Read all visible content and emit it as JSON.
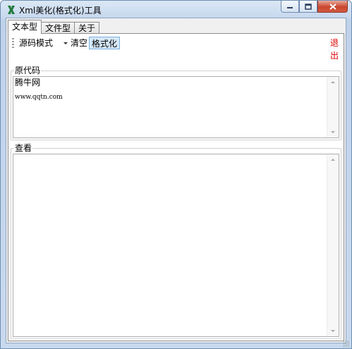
{
  "window": {
    "title": "Xml美化(格式化)工具",
    "icon": "excel-x-icon"
  },
  "tabs": [
    {
      "label": "文本型",
      "active": true
    },
    {
      "label": "文件型",
      "active": false
    },
    {
      "label": "关于",
      "active": false
    }
  ],
  "toolbar": {
    "mode_label": "源码模式",
    "clear_label": "清空",
    "format_label": "格式化",
    "exit_label": "退出"
  },
  "source_group": {
    "label": "原代码",
    "line1": "腾牛网",
    "line2": "www.qqtn.com"
  },
  "view_group": {
    "label": "查看",
    "content": ""
  },
  "colors": {
    "exit_text": "#e00000",
    "title_bar": "#c7d8ee",
    "close_button": "#c9462f"
  }
}
